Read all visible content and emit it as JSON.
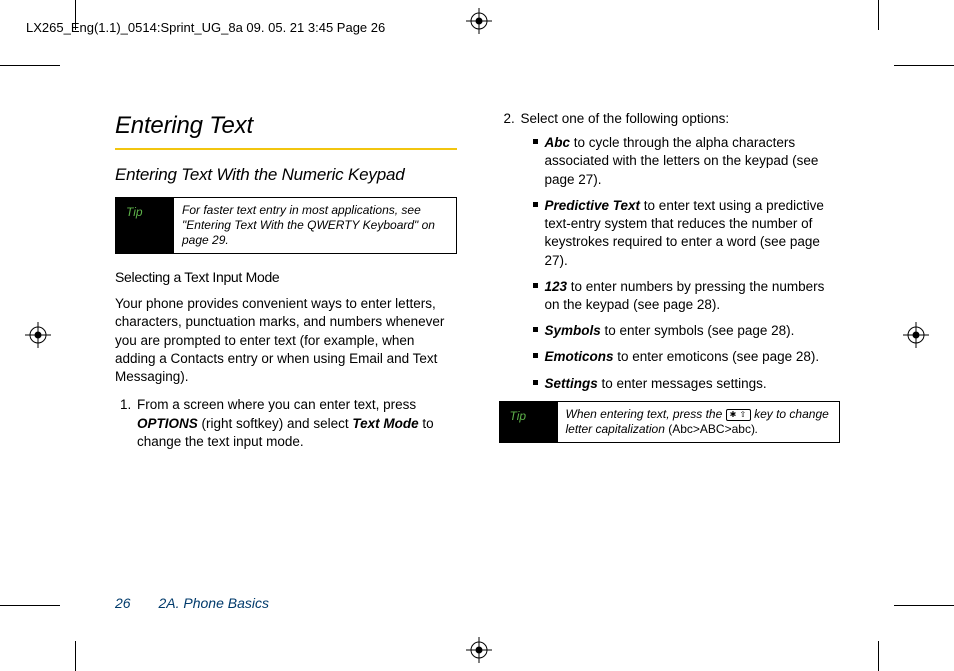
{
  "header_slug": "LX265_Eng(1.1)_0514:Sprint_UG_8a  09. 05. 21    3:45  Page 26",
  "section_title": "Entering Text",
  "subtitle": "Entering Text With the Numeric Keypad",
  "tip1": {
    "label": "Tip",
    "body": "For faster text entry in most applications, see \"Entering Text With the QWERTY Keyboard\" on page 29."
  },
  "minor_heading": "Selecting a Text Input Mode",
  "intro_para": "Your phone provides convenient ways to enter letters, characters, punctuation marks, and numbers whenever you are prompted to enter text (for example, when adding a Contacts entry or when using Email and Text Messaging).",
  "step1": {
    "pre": "From a screen where you can enter text, press ",
    "soft1": "OPTIONS",
    "mid": " (right softkey) and select ",
    "soft2": "Text Mode",
    "post": " to change the text input mode."
  },
  "step2_lead": "Select one of the following options:",
  "opts": {
    "abc": {
      "term": "Abc",
      "rest": " to cycle through the alpha characters associated with the letters on the keypad (see page 27)."
    },
    "pred": {
      "term": "Predictive Text",
      "rest": " to enter text using a predictive text-entry system that reduces the number of keystrokes required to enter a word (see page 27)."
    },
    "num": {
      "term": "123",
      "rest": " to enter numbers by pressing the numbers on the keypad (see page 28)."
    },
    "sym": {
      "term": "Symbols",
      "rest": " to enter symbols (see page 28)."
    },
    "emo": {
      "term": "Emoticons",
      "rest": " to enter emoticons (see page 28)."
    },
    "set": {
      "term": "Settings",
      "rest": " to enter messages settings."
    }
  },
  "tip2": {
    "label": "Tip",
    "pre": "When entering text, press the ",
    "key": "✱ ⇧",
    "mid": " key to change letter capitalization ",
    "paren": "(Abc>ABC>abc)",
    "post": "."
  },
  "footer": {
    "page": "26",
    "chapter": "2A. Phone Basics"
  }
}
